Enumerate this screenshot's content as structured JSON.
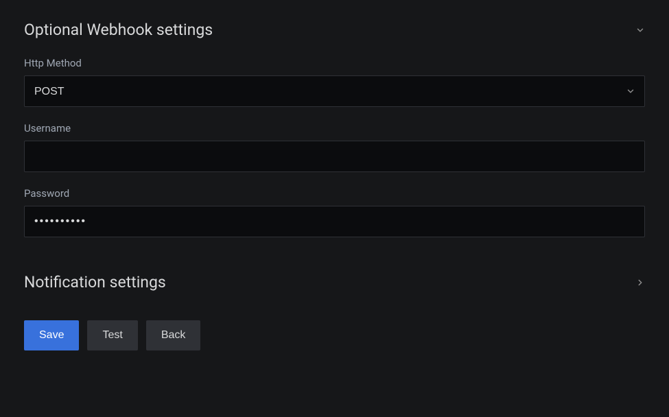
{
  "sections": {
    "webhook": {
      "title": "Optional Webhook settings",
      "http_method": {
        "label": "Http Method",
        "value": "POST"
      },
      "username": {
        "label": "Username",
        "value": ""
      },
      "password": {
        "label": "Password",
        "value": "••••••••••"
      }
    },
    "notification": {
      "title": "Notification settings"
    }
  },
  "buttons": {
    "save": "Save",
    "test": "Test",
    "back": "Back"
  }
}
